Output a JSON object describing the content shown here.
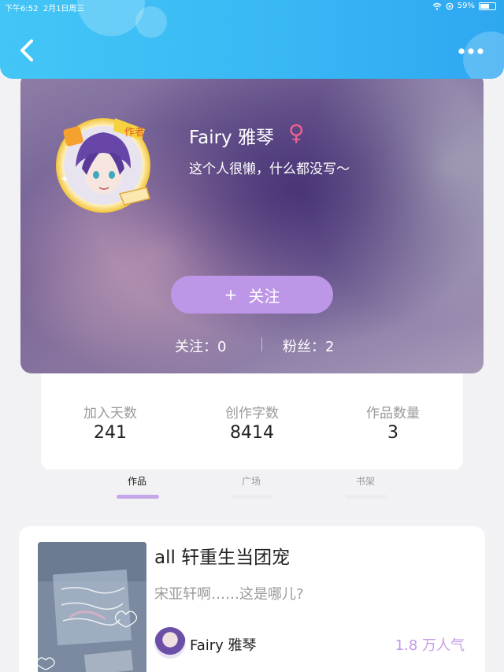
{
  "status_bar": {
    "time": "下午6:52",
    "date": "2月1日周三",
    "battery": "59%"
  },
  "profile": {
    "avatar_badge": "作者",
    "name": "Fairy 雅琴",
    "gender_symbol": "♀",
    "bio": "这个人很懒，什么都没写～",
    "follow_button": {
      "icon": "+",
      "label": "关注"
    },
    "following_label": "关注：0",
    "fans_label": "粉丝：2"
  },
  "stats": [
    {
      "label": "加入天数",
      "value": "241"
    },
    {
      "label": "创作字数",
      "value": "8414"
    },
    {
      "label": "作品数量",
      "value": "3"
    }
  ],
  "tabs": [
    {
      "label": "作品",
      "active": true
    },
    {
      "label": "广场",
      "active": false
    },
    {
      "label": "书架",
      "active": false
    }
  ],
  "book": {
    "title": "all 轩重生当团宠",
    "description": "宋亚轩啊……这是哪儿?",
    "author": "Fairy 雅琴",
    "popularity": "1.8 万人气"
  },
  "colors": {
    "header": "#39b8f4",
    "follow_button": "#bd96e8",
    "accent": "#c39be8",
    "gender": "#ee5f8c"
  },
  "icons": [
    "back-arrow-icon",
    "more-dots-icon",
    "wifi-icon",
    "battery-icon",
    "female-icon",
    "plus-icon"
  ]
}
